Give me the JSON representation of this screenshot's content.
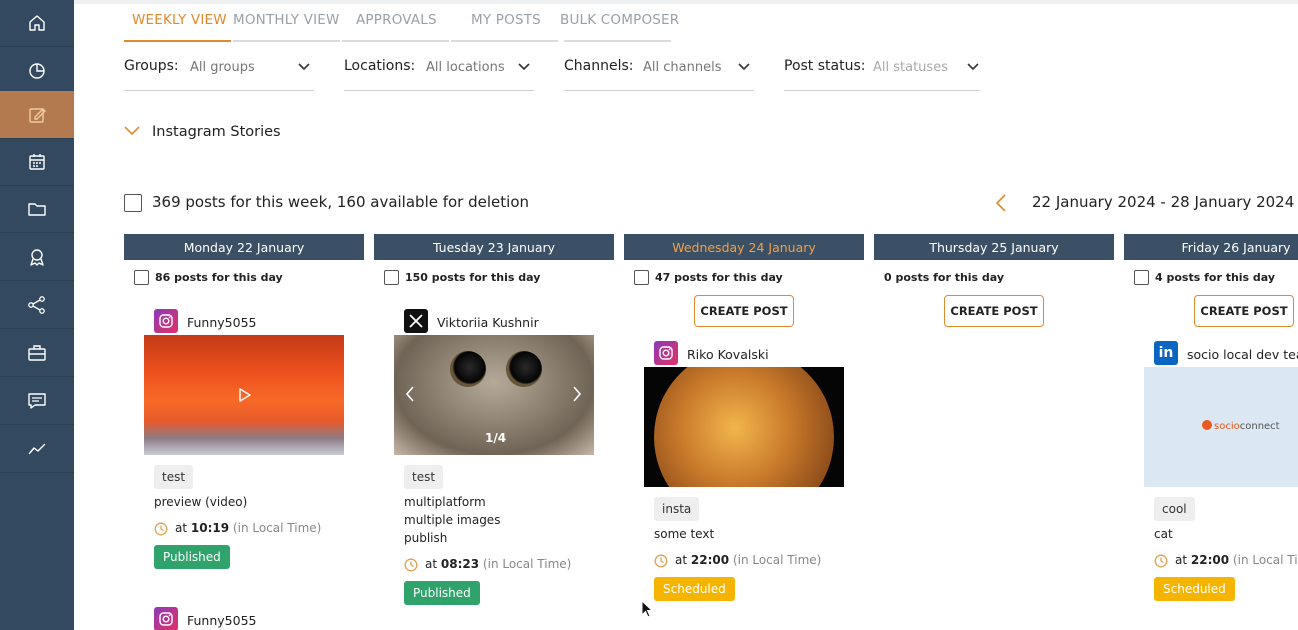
{
  "sidebar": {
    "items": [
      {
        "icon": "home-icon"
      },
      {
        "icon": "dashboard-icon"
      },
      {
        "icon": "compose-icon",
        "active": true
      },
      {
        "icon": "calendar-icon"
      },
      {
        "icon": "folder-icon"
      },
      {
        "icon": "reviews-icon"
      },
      {
        "icon": "share-icon"
      },
      {
        "icon": "briefcase-icon"
      },
      {
        "icon": "messages-icon"
      },
      {
        "icon": "analytics-icon"
      }
    ]
  },
  "tabs": [
    {
      "label": "WEEKLY VIEW",
      "active": true
    },
    {
      "label": "MONTHLY VIEW"
    },
    {
      "label": "APPROVALS"
    },
    {
      "label": "MY POSTS"
    },
    {
      "label": "BULK COMPOSER"
    }
  ],
  "filters": {
    "groups": {
      "label": "Groups:",
      "value": "All groups"
    },
    "locations": {
      "label": "Locations:",
      "value": "All locations"
    },
    "channels": {
      "label": "Channels:",
      "value": "All channels"
    },
    "post_status": {
      "label": "Post status:",
      "placeholder": "All statuses"
    }
  },
  "stories_label": "Instagram Stories",
  "summary": "369 posts for this week, 160 available for deletion",
  "date_range": "22 January 2024 - 28 January 2024",
  "create_post_label": "CREATE POST",
  "days": [
    {
      "header": "Monday 22 January",
      "count": "86 posts for this day"
    },
    {
      "header": "Tuesday 23 January",
      "count": "150 posts for this day"
    },
    {
      "header": "Wednesday 24 January",
      "count": "47 posts for this day",
      "today": true
    },
    {
      "header": "Thursday 25 January",
      "count": "0 posts for this day"
    },
    {
      "header": "Friday 26 January",
      "count": "4 posts for this day"
    }
  ],
  "posts": {
    "mon": {
      "network": "instagram",
      "author": "Funny5055",
      "tag": "test",
      "text": "preview (video)",
      "time": "10:19",
      "status": "Published"
    },
    "tue": {
      "network": "x",
      "author": "Viktoriia Kushnir",
      "tag": "test",
      "lines": [
        "multiplatform",
        "multiple images",
        "publish"
      ],
      "counter": "1/4",
      "time": "08:23",
      "status": "Published"
    },
    "wed": {
      "network": "instagram",
      "author": "Riko Kovalski",
      "tag": "insta",
      "text": "some text",
      "time": "22:00",
      "status": "Scheduled"
    },
    "fri": {
      "network": "linkedin",
      "author": "socio local dev team",
      "brand_a": "socio",
      "brand_b": "connect",
      "tag": "cool",
      "text": "cat",
      "time": "22:00",
      "status": "Scheduled"
    },
    "mon2": {
      "network": "instagram",
      "author": "Funny5055"
    }
  },
  "time_prefix": "at",
  "time_suffix": "(in Local Time)",
  "linkedin_glyph": "in",
  "colors": {
    "accent": "#e08a2e",
    "sidebar": "#33495f",
    "day_header": "#3b5064",
    "published": "#2fa36b",
    "scheduled": "#f5b400"
  }
}
